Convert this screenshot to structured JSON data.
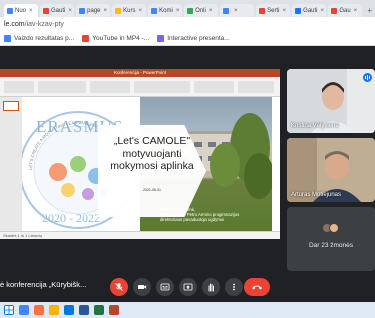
{
  "browser": {
    "tabs": [
      {
        "label": "Nuo",
        "color": "#4285f4"
      },
      {
        "label": "Gauti",
        "color": "#ea4335"
      },
      {
        "label": "page",
        "color": "#4285f4"
      },
      {
        "label": "Kurs",
        "color": "#fbbc04"
      },
      {
        "label": "Komi",
        "color": "#4285f4"
      },
      {
        "label": "Onli",
        "color": "#34a853"
      },
      {
        "label": "",
        "color": "#4285f4"
      },
      {
        "label": "Serti",
        "color": "#ea4335"
      },
      {
        "label": "Gauti",
        "color": "#1877f2"
      },
      {
        "label": "Gau",
        "color": "#ea4335"
      }
    ],
    "new_tab_symbol": "+",
    "url_host": "le.com",
    "url_path": "/iav-kzav-pty",
    "bookmarks": [
      {
        "label": "Vaizdo rezultatas p...",
        "icon": "image-icon",
        "color": "#4285f4"
      },
      {
        "label": "YouTube in MP4 -...",
        "icon": "youtube-icon",
        "color": "#ea4335"
      },
      {
        "label": "Interactive presenta...",
        "icon": "presentation-icon",
        "color": "#7b61ff"
      }
    ]
  },
  "slide": {
    "window_title": "Konferencija - PowerPoint",
    "title": "„Let's CAMOLE\" motyvuojanti mokymosi aplinka",
    "date": "2021-06-01",
    "authors": "Kristina Vėlyvienė,\nMarijampolės Petro Armino progimnazijos\ndirektoriaus pavaduotoja ugdymui",
    "logo_text": "ERASMUS",
    "logo_years": "2020 - 2022",
    "logo_ring_text": "LET'S CREATE A MOTIVATING LEARNING ENVIRONMENT",
    "status_text": "Skaidrė 1 iš 1  Lietuvių"
  },
  "participants": [
    {
      "name": "Kristina Vėlyvienė",
      "speaking": true
    },
    {
      "name": "Arturas Motiejunas",
      "speaking": false
    }
  ],
  "others": {
    "label": "Dar 23 žmonės"
  },
  "meeting": {
    "title": "ė konferencija „Kūrybišk..."
  },
  "controls": [
    {
      "name": "mic-off-button",
      "icon": "mic-off-icon",
      "red": true
    },
    {
      "name": "camera-button",
      "icon": "camera-icon",
      "red": false
    },
    {
      "name": "captions-button",
      "icon": "captions-icon",
      "red": false
    },
    {
      "name": "present-button",
      "icon": "present-icon",
      "red": false
    },
    {
      "name": "raise-hand-button",
      "icon": "hand-icon",
      "red": false
    },
    {
      "name": "more-options-button",
      "icon": "more-vert-icon",
      "red": false
    }
  ],
  "colors": {
    "meet_bg": "#202124",
    "end_call": "#ea4335",
    "speaking_blue": "#1a73e8",
    "ppt_red": "#b7472a"
  },
  "taskbar": [
    {
      "name": "chrome-taskbar-icon",
      "color": "#4285f4"
    },
    {
      "name": "firefox-taskbar-icon",
      "color": "#ff7139"
    },
    {
      "name": "folder-taskbar-icon",
      "color": "#f4b400"
    },
    {
      "name": "edge-taskbar-icon",
      "color": "#0078d4"
    },
    {
      "name": "word-taskbar-icon",
      "color": "#2b579a"
    },
    {
      "name": "excel-taskbar-icon",
      "color": "#217346"
    },
    {
      "name": "powerpoint-taskbar-icon",
      "color": "#b7472a"
    }
  ]
}
